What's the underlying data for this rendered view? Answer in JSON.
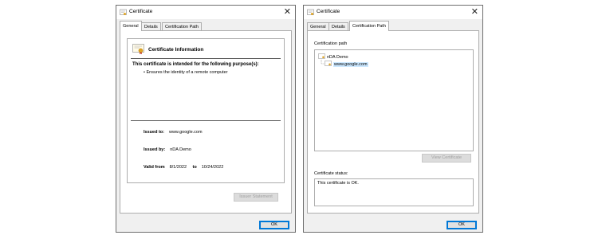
{
  "left_window": {
    "title": "Certificate",
    "tabs": [
      {
        "label": "General",
        "active": true
      },
      {
        "label": "Details",
        "active": false
      },
      {
        "label": "Certification Path",
        "active": false
      }
    ],
    "header_title": "Certificate Information",
    "purpose_heading": "This certificate is intended for the following purpose(s):",
    "purposes": [
      "Ensures the identity of a remote computer"
    ],
    "issued_to_label": "Issued to:",
    "issued_to_value": "www.google.com",
    "issued_by_label": "Issued by:",
    "issued_by_value": "nDA Demo",
    "valid_from_label": "Valid from",
    "valid_from_value": "8/1/2022",
    "valid_to_label": "to",
    "valid_to_value": "10/24/2022",
    "issuer_statement_label": "Issuer Statement",
    "ok_label": "OK"
  },
  "right_window": {
    "title": "Certificate",
    "tabs": [
      {
        "label": "General",
        "active": false
      },
      {
        "label": "Details",
        "active": false
      },
      {
        "label": "Certification Path",
        "active": true
      }
    ],
    "path_label": "Certification path",
    "path_items": [
      "nDA Demo",
      "www.google.com"
    ],
    "view_certificate_label": "View Certificate",
    "status_label": "Certificate status:",
    "status_text": "This certificate is OK.",
    "ok_label": "OK"
  },
  "icons": {
    "window_icon": "certificate-icon",
    "close": "close-icon",
    "tree_node": "certificate-icon"
  },
  "colors": {
    "window_bg": "#f0f0f0",
    "default_button_border": "#0078d7",
    "disabled_text": "#a0a0a0"
  }
}
